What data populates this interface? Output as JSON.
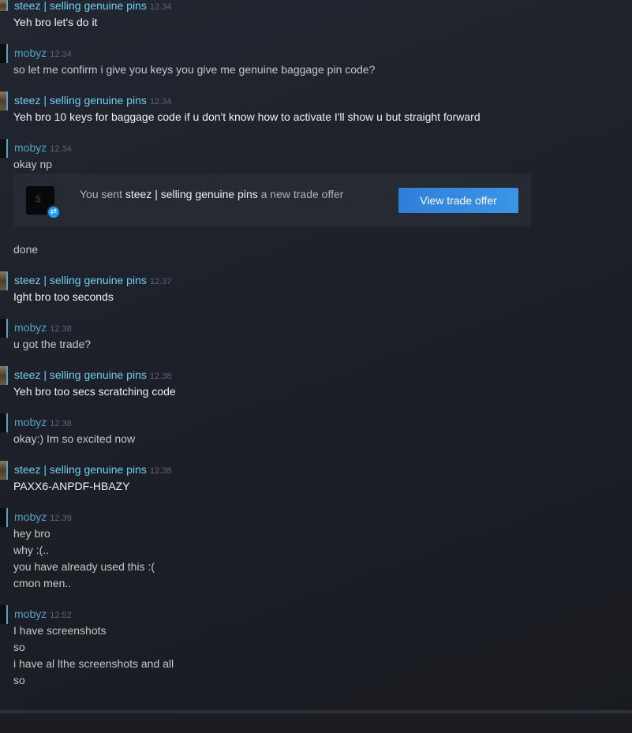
{
  "messages": [
    {
      "sender": "steez | selling genuine pins",
      "time": "12.34",
      "lines": [
        "Yeh bro let's do it"
      ]
    },
    {
      "sender": "mobyz",
      "time": "12.34",
      "lines": [
        "so let me confirm i give you keys you give me genuine baggage pin code?"
      ]
    },
    {
      "sender": "steez | selling genuine pins",
      "time": "12.34",
      "lines": [
        "Yeh bro 10 keys for baggage code if u don't know how to activate I'll show u but straight forward"
      ]
    },
    {
      "sender": "mobyz",
      "time": "12.34",
      "lines": [
        "okay np",
        "done"
      ]
    },
    {
      "sender": "steez | selling genuine pins",
      "time": "12.37",
      "lines": [
        "Ight bro too seconds"
      ]
    },
    {
      "sender": "mobyz",
      "time": "12.38",
      "lines": [
        "u got the trade?"
      ]
    },
    {
      "sender": "steez | selling genuine pins",
      "time": "12.38",
      "lines": [
        "Yeh bro too secs scratching code"
      ]
    },
    {
      "sender": "mobyz",
      "time": "12.38",
      "lines": [
        "okay:) Im so excited now"
      ]
    },
    {
      "sender": "steez | selling genuine pins",
      "time": "12.38",
      "lines": [
        "PAXX6-ANPDF-HBAZY"
      ]
    },
    {
      "sender": "mobyz",
      "time": "12.39",
      "lines": [
        "hey bro",
        "why :(..",
        "you have already used this :(",
        "cmon men.."
      ]
    },
    {
      "sender": "mobyz",
      "time": "12.52",
      "lines": [
        "I have screenshots",
        "so",
        "i have al lthe screenshots and all",
        "so"
      ]
    }
  ],
  "trade_offer": {
    "prefix": "You sent",
    "recipient": "steez | selling genuine pins",
    "suffix": "a new trade offer",
    "button_label": "View trade offer",
    "icon": "dollar-sign",
    "badge_icon": "trade-arrows-icon"
  },
  "colors": {
    "steez_name": "#6dcff6",
    "mobyz_name": "#53a4c4",
    "button": "#3b95e8"
  }
}
